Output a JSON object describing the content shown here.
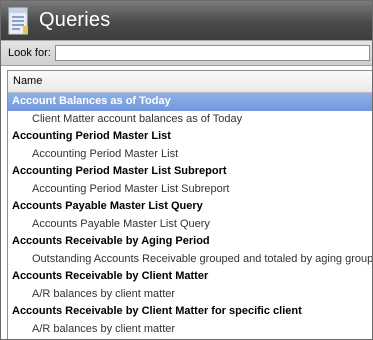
{
  "header": {
    "title": "Queries",
    "icon": "queries-document-icon"
  },
  "search": {
    "label": "Look for:",
    "value": ""
  },
  "list": {
    "column_header": "Name",
    "items": [
      {
        "title": "Account Balances as of Today",
        "description": "Client Matter account balances as of Today",
        "selected": true
      },
      {
        "title": "Accounting Period Master List",
        "description": "Accounting Period Master List"
      },
      {
        "title": "Accounting Period Master List Subreport",
        "description": "Accounting Period Master List Subreport"
      },
      {
        "title": "Accounts Payable Master List Query",
        "description": "Accounts Payable Master List Query"
      },
      {
        "title": "Accounts Receivable by Aging Period",
        "description": "Outstanding Accounts Receivable grouped and totaled by aging group"
      },
      {
        "title": "Accounts Receivable by Client Matter",
        "description": "A/R balances by client matter"
      },
      {
        "title": "Accounts Receivable by Client Matter for specific client",
        "description": "A/R balances by client matter"
      }
    ]
  },
  "colors": {
    "selection": "#7a9de0",
    "header_bg": "#4a4a4a"
  }
}
